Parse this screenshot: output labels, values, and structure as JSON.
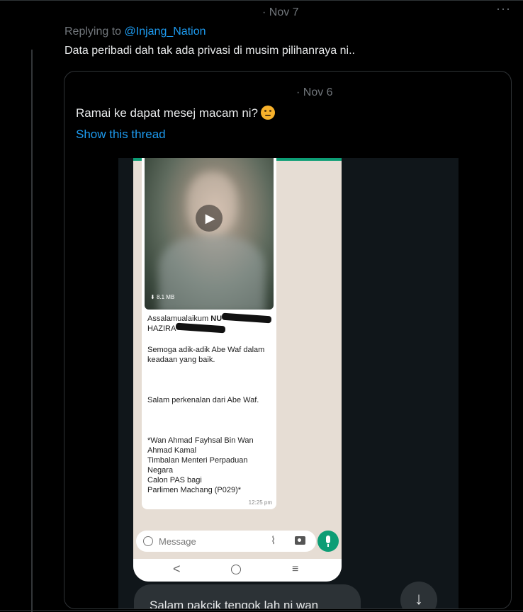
{
  "tweet": {
    "date": "· Nov 7",
    "more_label": "···",
    "replying_prefix": "Replying to ",
    "replying_handle": "@Injang_Nation",
    "text": "Data peribadi dah tak ada privasi di musim pilihanraya ni.."
  },
  "quote": {
    "date": "· Nov 6",
    "text": "Ramai ke dapat mesej macam ni?",
    "emoji": "thinking-face-emoji",
    "show_thread": "Show this thread"
  },
  "media": {
    "video_size": "8.1 MB",
    "greeting": "Assalamualaikum",
    "greeting_name_partial": "NU",
    "greeting_line2_partial": "HAZIRA",
    "line_wellwish": "Semoga adik-adik Abe Waf dalam keadaan yang baik.",
    "line_intro": "Salam perkenalan dari Abe Waf.",
    "signature": [
      "*Wan Ahmad Fayhsal Bin Wan Ahmad Kamal",
      "Timbalan Menteri Perpaduan Negara",
      "Calon PAS bagi",
      "Parlimen Machang (P029)*"
    ],
    "time": "12:25 pm",
    "composer_placeholder": "Message",
    "nav_back": "<",
    "nav_menu": "≡",
    "caption": "Salam pakcik tengok lah ni wan",
    "scroll_down_icon": "arrow-down-icon"
  }
}
